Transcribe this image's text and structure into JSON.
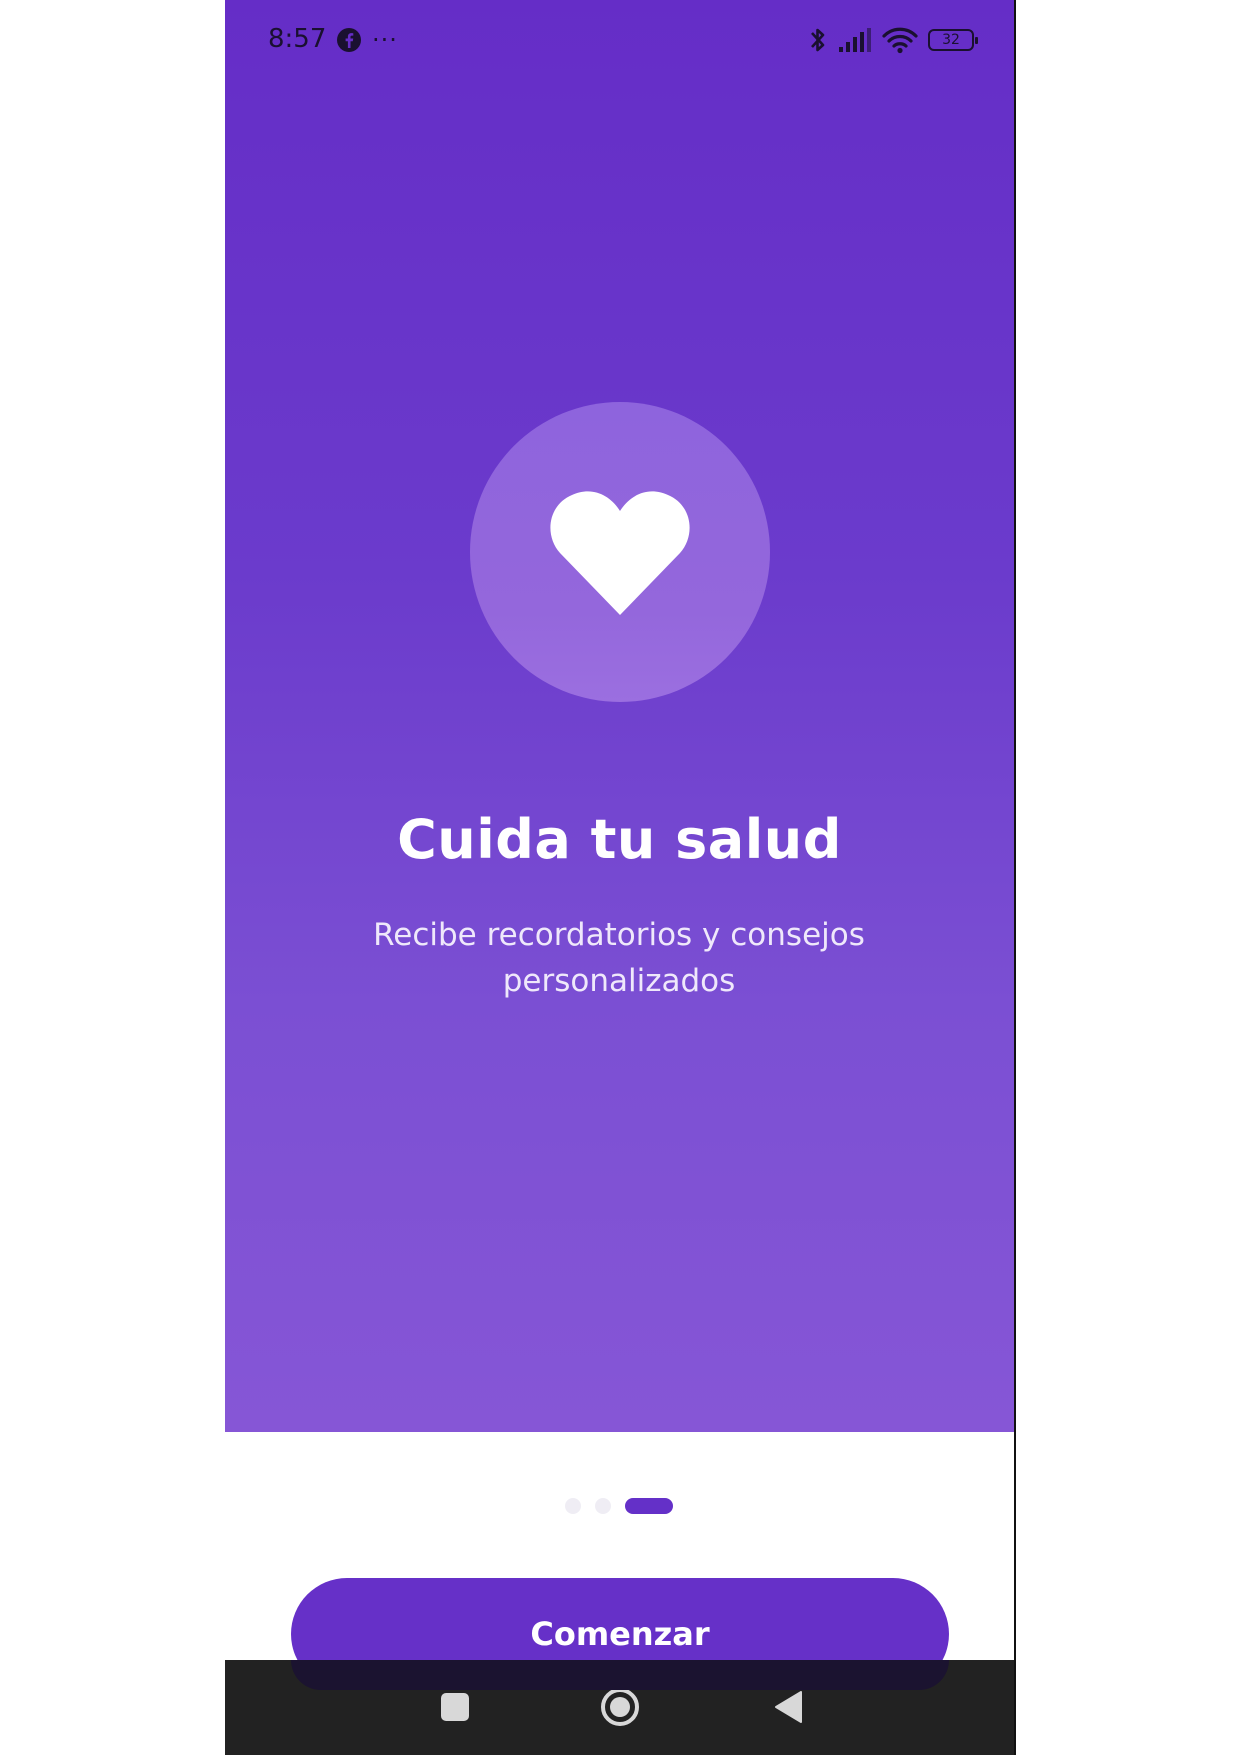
{
  "status_bar": {
    "time": "8:57",
    "battery_level": "32",
    "icons": [
      "facebook-icon",
      "more-dots-icon",
      "bluetooth-icon",
      "signal-icon",
      "wifi-icon",
      "battery-icon"
    ]
  },
  "onboarding": {
    "icon": "heart-icon",
    "title": "Cuida tu salud",
    "subtitle": "Recibe recordatorios y consejos personalizados",
    "page_indicator": {
      "total": 3,
      "current": 3
    },
    "cta_label": "Comenzar"
  },
  "nav_bar": {
    "buttons": [
      "recents-square-icon",
      "home-circle-icon",
      "back-triangle-icon"
    ]
  },
  "colors": {
    "primary": "#6630c8",
    "hero_top": "#652dc7",
    "hero_bottom": "#8656d6",
    "dot_inactive": "#efedf4",
    "navbar": "#222222"
  }
}
